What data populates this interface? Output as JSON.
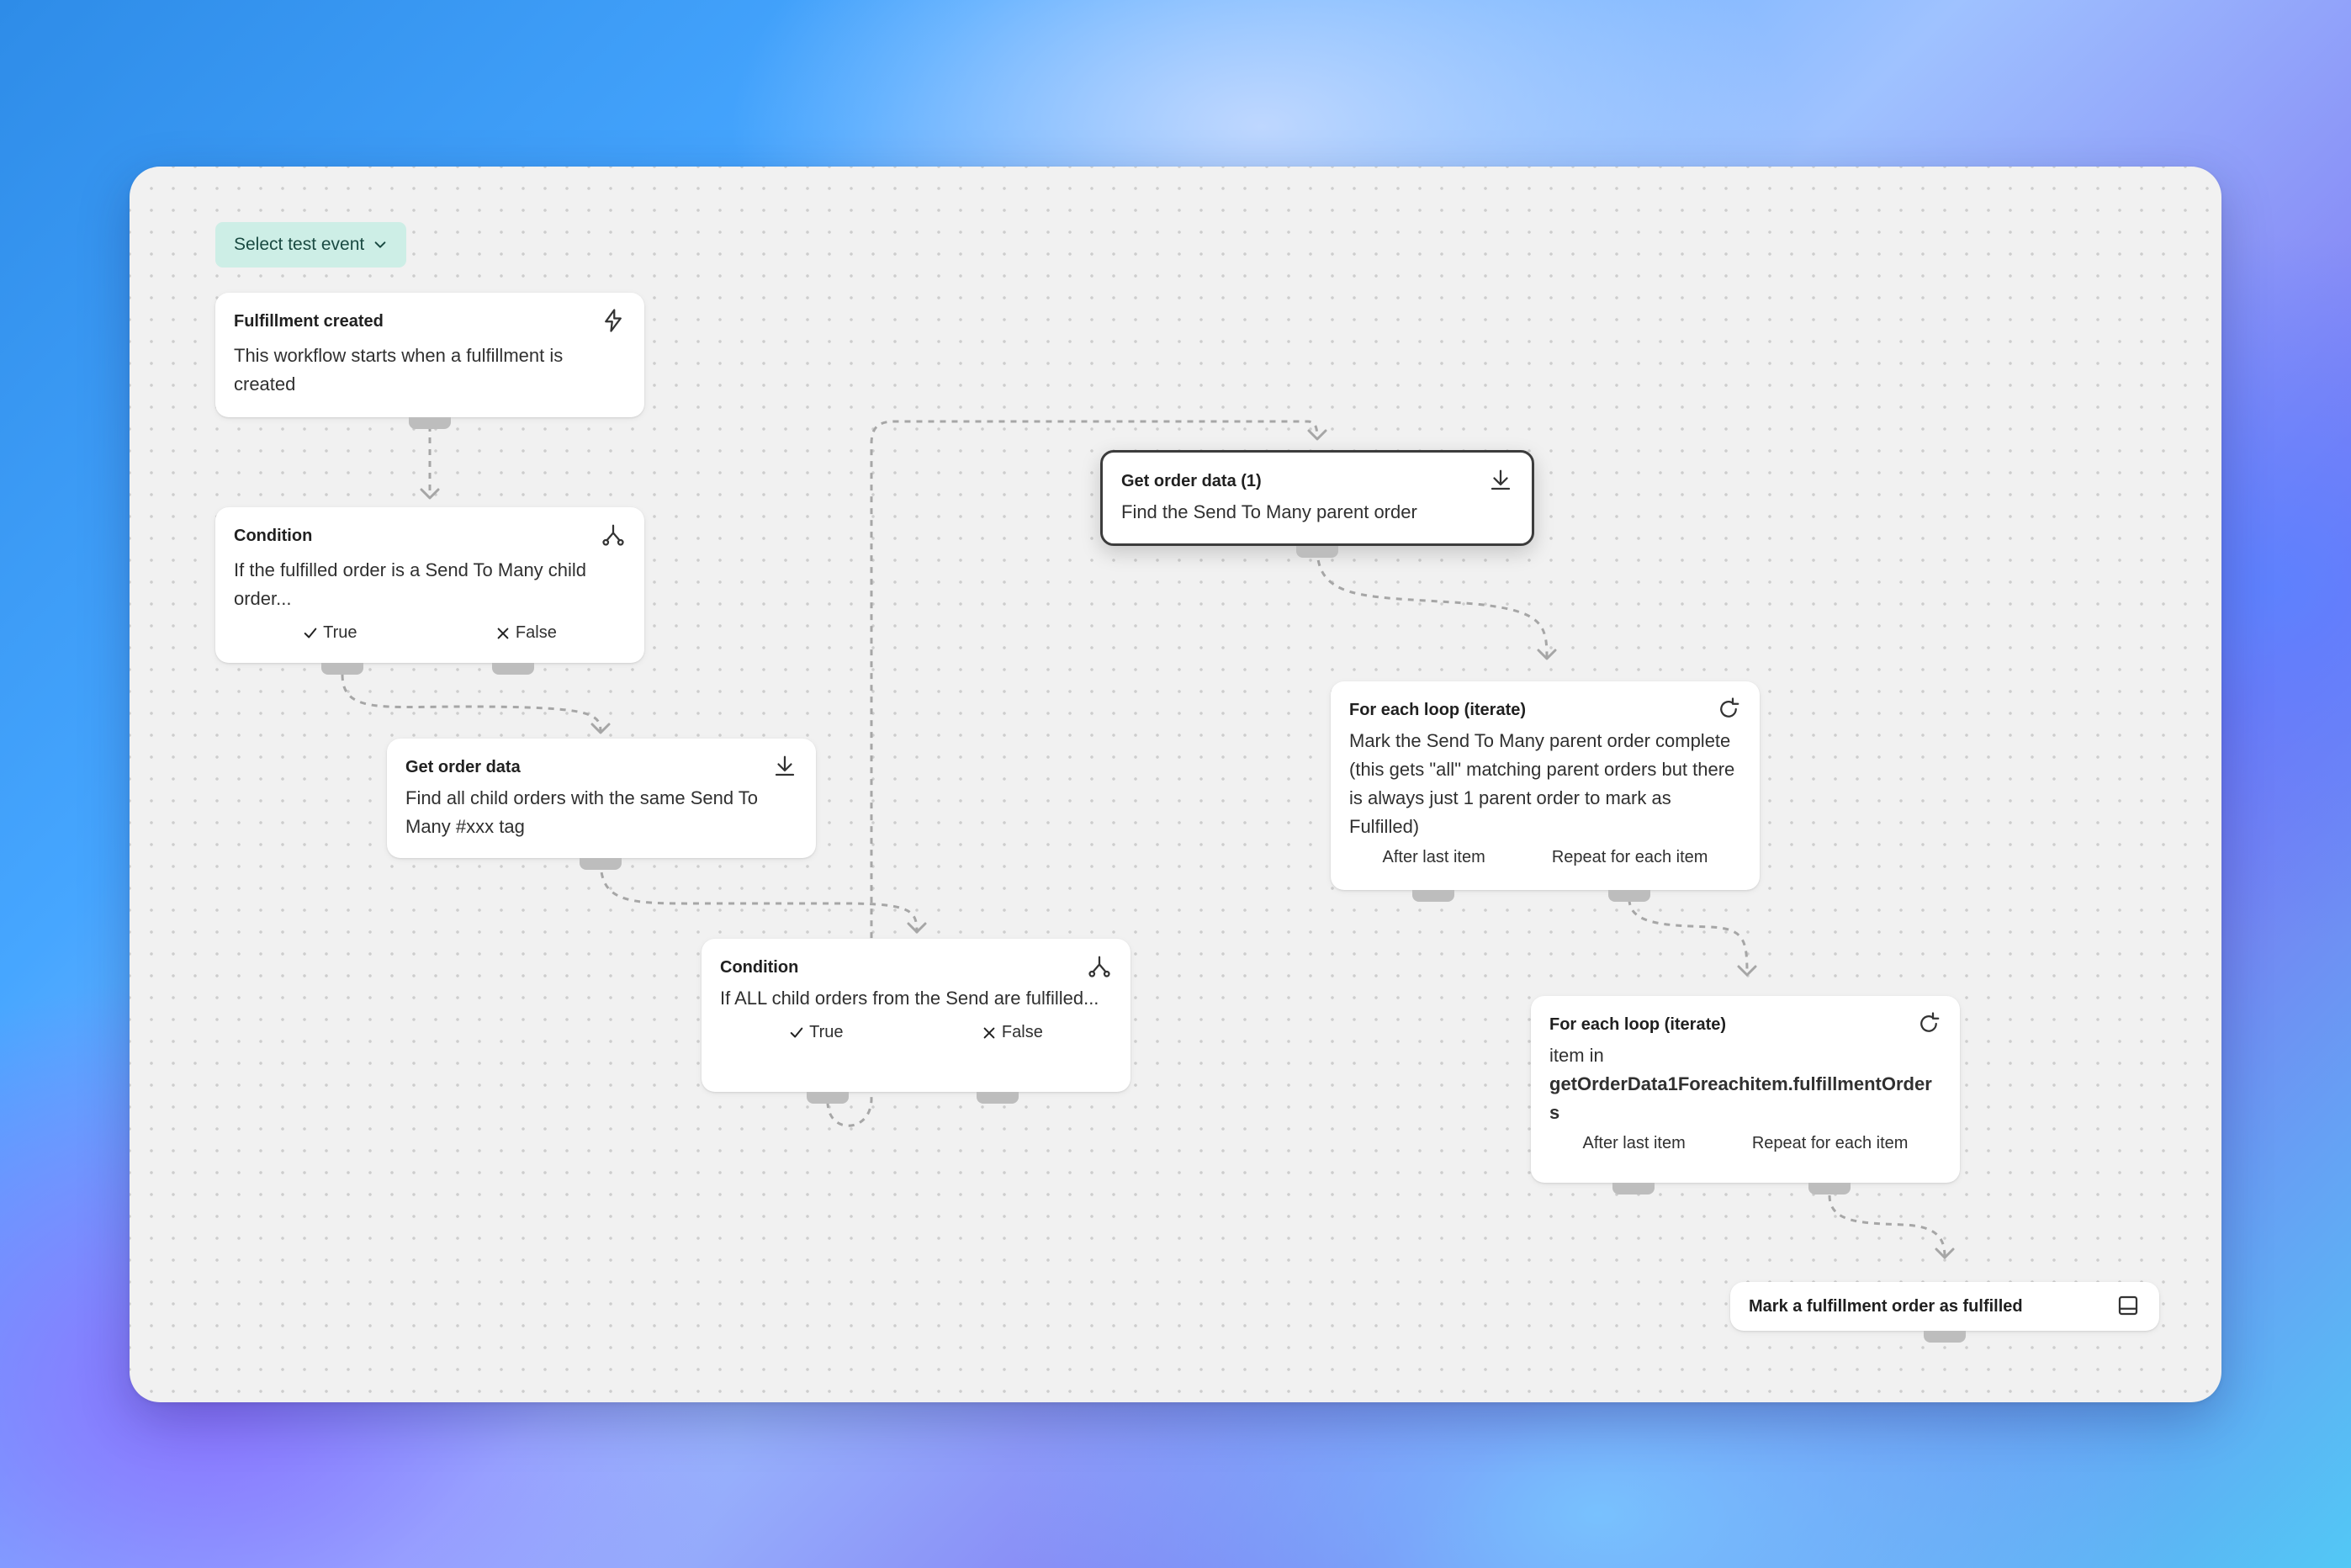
{
  "toolbar": {
    "test_event_label": "Select test event"
  },
  "nodes": {
    "trigger": {
      "title": "Fulfillment created",
      "desc": "This workflow starts when a fulfillment is created",
      "icon": "lightning-icon"
    },
    "condition1": {
      "title": "Condition",
      "desc": "If the fulfilled order is a Send To Many child order...",
      "true_label": "True",
      "false_label": "False",
      "icon": "branch-icon"
    },
    "get_order_data": {
      "title": "Get order data",
      "desc": "Find all child orders with the same Send To Many #xxx tag",
      "icon": "download-icon"
    },
    "condition2": {
      "title": "Condition",
      "desc": "If ALL child orders from the Send are fulfilled...",
      "true_label": "True",
      "false_label": "False",
      "icon": "branch-icon"
    },
    "get_order_data_1": {
      "title": "Get order data (1)",
      "desc": "Find the Send To Many parent order",
      "icon": "download-icon"
    },
    "loop1": {
      "title": "For each loop (iterate)",
      "desc": "Mark the Send To Many parent order complete (this gets \"all\" matching parent orders but there is always just 1 parent order to mark as Fulfilled)",
      "after_label": "After last item",
      "repeat_label": "Repeat for each item",
      "icon": "refresh-icon"
    },
    "loop2": {
      "title": "For each loop (iterate)",
      "desc_prefix": "item in",
      "desc_var": "getOrderData1Foreachitem.fulfillmentOrders",
      "after_label": "After last item",
      "repeat_label": "Repeat for each item",
      "icon": "refresh-icon"
    },
    "mark_fulfilled": {
      "title": "Mark a fulfillment order as fulfilled",
      "icon": "inbox-icon"
    }
  }
}
